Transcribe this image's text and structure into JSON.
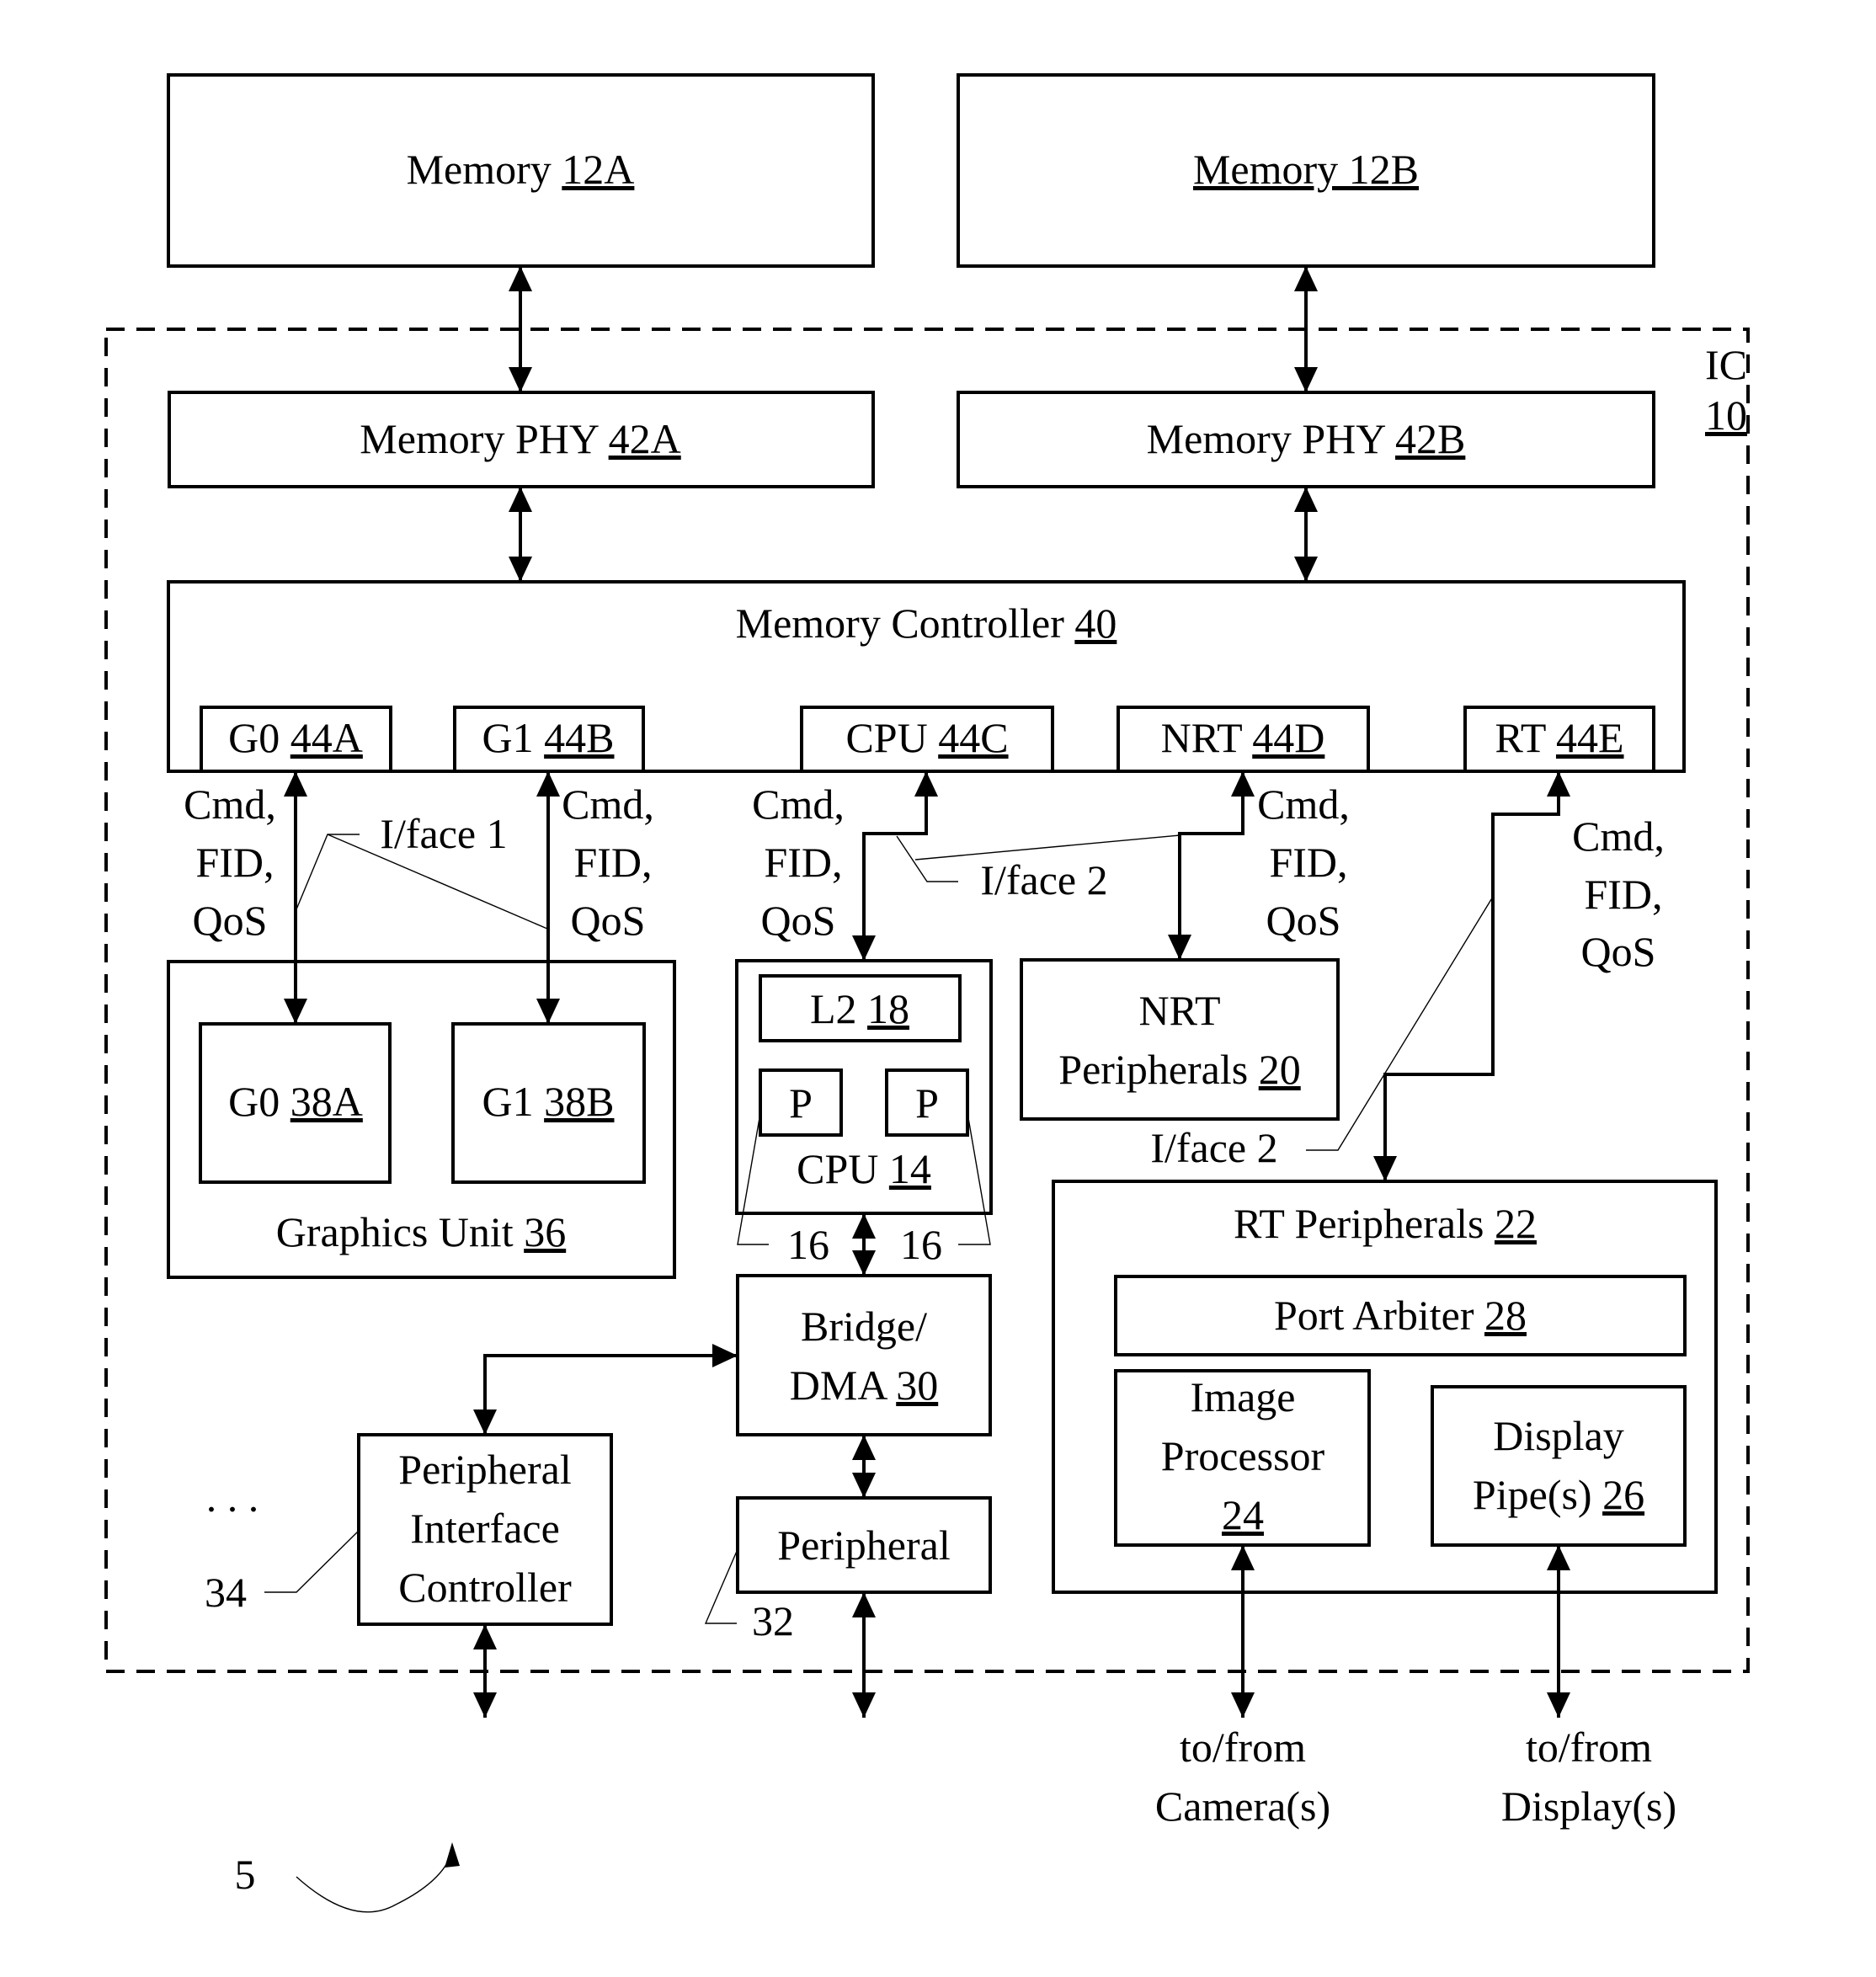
{
  "figure": {
    "reference": "5",
    "ic": {
      "name": "IC",
      "ref": "10"
    }
  },
  "blocks": {
    "memory_a": {
      "name": "Memory",
      "ref": "12A"
    },
    "memory_b": {
      "name": "Memory 12B"
    },
    "phy_a": {
      "name": "Memory PHY",
      "ref": "42A"
    },
    "phy_b": {
      "name": "Memory PHY",
      "ref": "42B"
    },
    "mem_ctrl": {
      "name": "Memory Controller",
      "ref": "40"
    },
    "ports": [
      {
        "name": "G0",
        "ref": "44A"
      },
      {
        "name": "G1",
        "ref": "44B"
      },
      {
        "name": "CPU",
        "ref": "44C"
      },
      {
        "name": "NRT",
        "ref": "44D"
      },
      {
        "name": "RT",
        "ref": "44E"
      }
    ],
    "graphics_unit": {
      "name": "Graphics Unit",
      "ref": "36"
    },
    "g0": {
      "name": "G0",
      "ref": "38A"
    },
    "g1": {
      "name": "G1",
      "ref": "38B"
    },
    "cpu": {
      "name": "CPU",
      "ref": "14"
    },
    "l2": {
      "name": "L2",
      "ref": "18"
    },
    "processor_label": "P",
    "processor_ref": "16",
    "nrt_periph": {
      "line1": "NRT",
      "line2": "Peripherals",
      "ref": "20"
    },
    "rt_periph": {
      "name": "RT Peripherals",
      "ref": "22"
    },
    "port_arbiter": {
      "name": "Port Arbiter",
      "ref": "28"
    },
    "image_proc": {
      "line1": "Image",
      "line2": "Processor",
      "ref": "24"
    },
    "display_pipe": {
      "line1": "Display",
      "line2": "Pipe(s)",
      "ref": "26"
    },
    "bridge": {
      "line1": "Bridge/",
      "line2": "DMA",
      "ref": "30"
    },
    "peripheral": {
      "name": "Peripheral",
      "ref": "32"
    },
    "pic": {
      "line1": "Peripheral",
      "line2": "Interface",
      "line3": "Controller",
      "ref": "34"
    },
    "ellipsis": ". . ."
  },
  "signals": {
    "cmd": "Cmd,",
    "fid": "FID,",
    "qos": "QoS",
    "iface1": "I/face 1",
    "iface2": "I/face 2"
  },
  "external": {
    "camera": {
      "line1": "to/from",
      "line2": "Camera(s)"
    },
    "display": {
      "line1": "to/from",
      "line2": "Display(s)"
    }
  }
}
